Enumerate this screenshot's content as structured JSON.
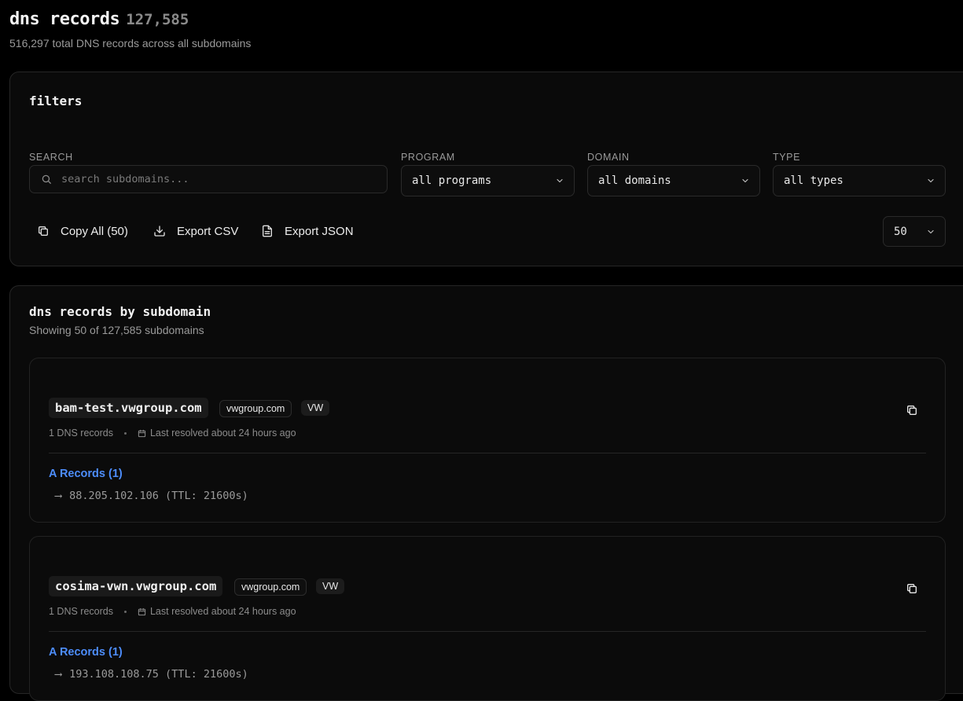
{
  "header": {
    "title": "dns records",
    "count": "127,585",
    "subtitle": "516,297 total DNS records across all subdomains"
  },
  "filters": {
    "title": "filters",
    "search": {
      "label": "SEARCH",
      "placeholder": "search subdomains..."
    },
    "program": {
      "label": "PROGRAM",
      "value": "all programs"
    },
    "domain": {
      "label": "DOMAIN",
      "value": "all domains"
    },
    "type": {
      "label": "TYPE",
      "value": "all types"
    },
    "actions": {
      "copy_all": "Copy All (50)",
      "export_csv": "Export CSV",
      "export_json": "Export JSON"
    },
    "page_size": "50"
  },
  "records": {
    "title": "dns records by subdomain",
    "subtitle": "Showing 50 of 127,585 subdomains",
    "items": [
      {
        "host": "bam-test.vwgroup.com",
        "domain": "vwgroup.com",
        "program": "VW",
        "dns_count": "1 DNS records",
        "resolved": "Last resolved about 24 hours ago",
        "section_label": "A Records (1)",
        "arrow": "⟶",
        "record": "88.205.102.106 (TTL: 21600s)"
      },
      {
        "host": "cosima-vwn.vwgroup.com",
        "domain": "vwgroup.com",
        "program": "VW",
        "dns_count": "1 DNS records",
        "resolved": "Last resolved about 24 hours ago",
        "section_label": "A Records (1)",
        "arrow": "⟶",
        "record": "193.108.108.75 (TTL: 21600s)"
      }
    ]
  },
  "colors": {
    "background": "#000000",
    "card": "#0a0a0a",
    "border": "#262626",
    "accent_blue": "#4d8dfb",
    "muted": "#9a9a9a"
  },
  "icons": {
    "search": "search-icon",
    "chevron": "chevron-down-icon",
    "copy": "copy-icon",
    "download": "download-icon",
    "file": "file-icon",
    "calendar": "calendar-icon"
  }
}
